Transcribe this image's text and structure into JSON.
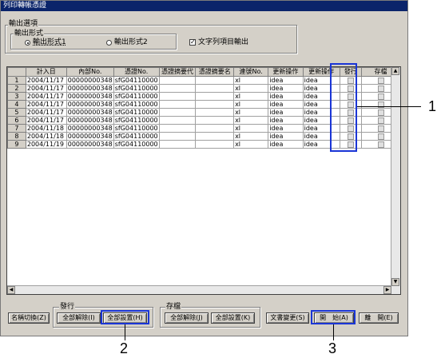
{
  "window": {
    "title": "列印轉帳憑證"
  },
  "output_options": {
    "group_label": "輸出選項",
    "format_group_label": "輸出形式",
    "format1_label": "輸出形式1",
    "format2_label": "輸出形式2",
    "selected_format": "format1",
    "text_output_label": "文字列項目輸出",
    "text_output_checked": true
  },
  "grid": {
    "columns": [
      "",
      "計入日",
      "內部No.",
      "憑證No.",
      "憑證摘要代",
      "憑證摘要名",
      "連號No.",
      "更新操作",
      "更新操作",
      "發行",
      "存檔"
    ],
    "rows": [
      {
        "num": "1",
        "date": "2004/11/17",
        "internal": "00000000348",
        "voucher": "sfG04110000",
        "seq": "xl",
        "op1": "idea",
        "op2": "idea"
      },
      {
        "num": "2",
        "date": "2004/11/17",
        "internal": "00000000348",
        "voucher": "sfG04110000",
        "seq": "xl",
        "op1": "idea",
        "op2": "idea"
      },
      {
        "num": "3",
        "date": "2004/11/17",
        "internal": "00000000348",
        "voucher": "sfG04110000",
        "seq": "xl",
        "op1": "idea",
        "op2": "idea"
      },
      {
        "num": "4",
        "date": "2004/11/17",
        "internal": "00000000348",
        "voucher": "sfG04110000",
        "seq": "xl",
        "op1": "idea",
        "op2": "idea"
      },
      {
        "num": "5",
        "date": "2004/11/17",
        "internal": "00000000348",
        "voucher": "sfG04110000",
        "seq": "xl",
        "op1": "idea",
        "op2": "idea"
      },
      {
        "num": "6",
        "date": "2004/11/17",
        "internal": "00000000348",
        "voucher": "sfG04110000",
        "seq": "xl",
        "op1": "idea",
        "op2": "idea"
      },
      {
        "num": "7",
        "date": "2004/11/18",
        "internal": "00000000348",
        "voucher": "sfG04110000",
        "seq": "xl",
        "op1": "idea",
        "op2": "idea"
      },
      {
        "num": "8",
        "date": "2004/11/18",
        "internal": "00000000348",
        "voucher": "sfG04110000",
        "seq": "xl",
        "op1": "idea",
        "op2": "idea"
      },
      {
        "num": "9",
        "date": "2004/11/19",
        "internal": "00000000348",
        "voucher": "sfG04110000",
        "seq": "xl",
        "op1": "idea",
        "op2": "idea"
      }
    ]
  },
  "bottom": {
    "name_switch": "名稱切換(Z)",
    "issue_group_label": "發行",
    "issue_clear": "全部解除(I)",
    "issue_set": "全部設置(H)",
    "save_group_label": "存檔",
    "save_clear": "全部解除(J)",
    "save_set": "全部設置(K)",
    "doc_change": "文書變更(S)",
    "start": "開　始(A)",
    "close": "離　開(E)"
  },
  "callouts": [
    "1",
    "2",
    "3"
  ],
  "colors": {
    "highlight": "#1a35d6",
    "titlebar": "#0a246a",
    "face": "#d4d0c8"
  }
}
